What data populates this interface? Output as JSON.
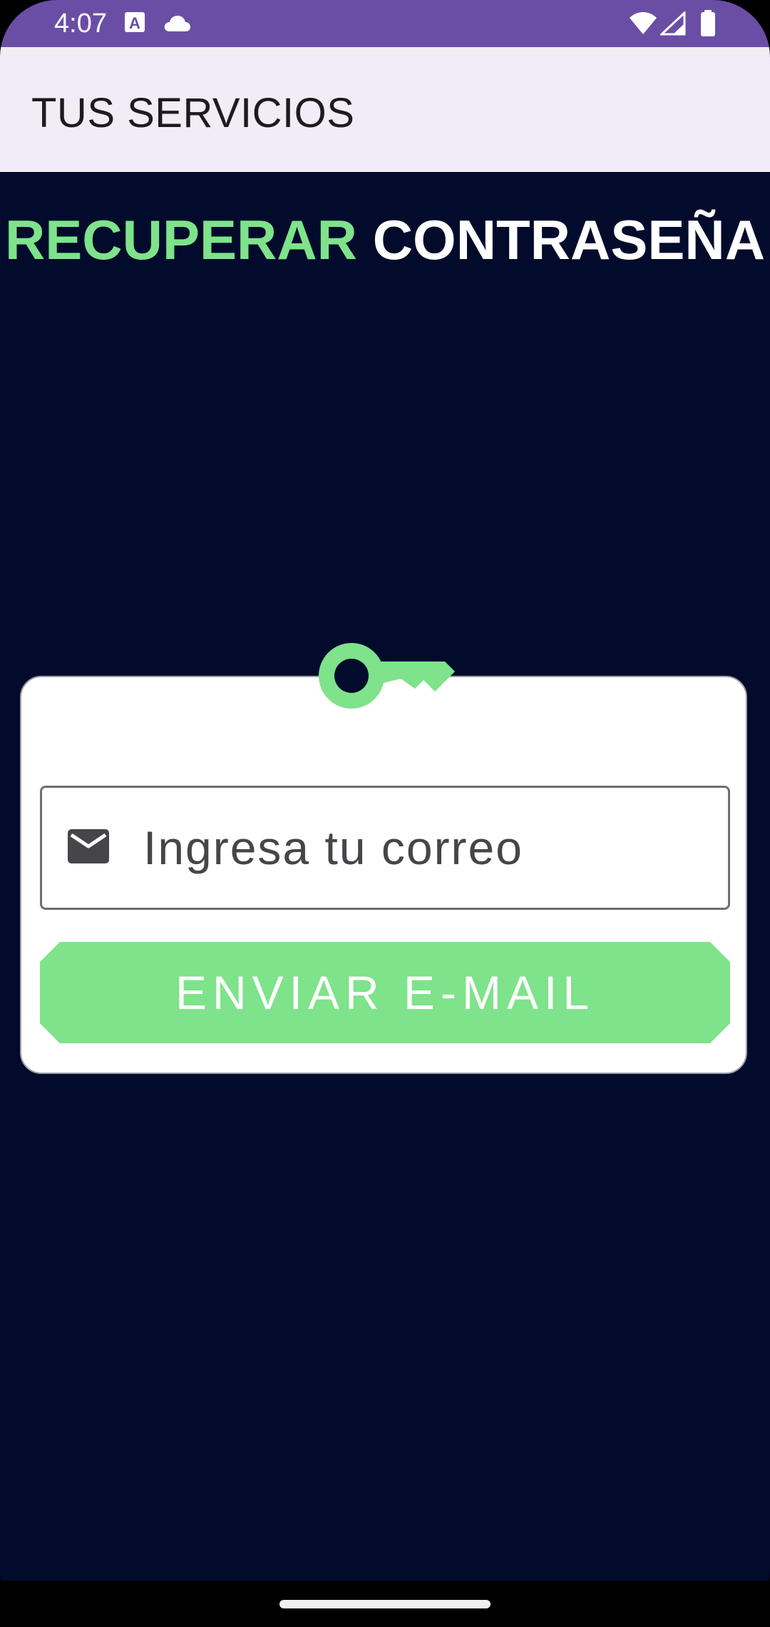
{
  "status_bar": {
    "time": "4:07",
    "icons": [
      "text-a-icon",
      "cloud-icon",
      "wifi-icon",
      "signal-icon",
      "battery-icon"
    ],
    "background_color": "#6a4ea5"
  },
  "app_bar": {
    "title": "TUS SERVICIOS",
    "background_color": "#f1ecf5"
  },
  "headline": {
    "part1": "RECUPERAR",
    "part2": "CONTRASEÑA",
    "part1_color": "#7ee38a",
    "part2_color": "#ffffff"
  },
  "form": {
    "key_icon": "key-icon",
    "email": {
      "icon": "mail-icon",
      "placeholder": "Ingresa tu correo",
      "value": ""
    },
    "submit_label": "ENVIAR E-MAIL",
    "accent_color": "#7ee38a"
  },
  "theme": {
    "background": "#020b2b"
  }
}
